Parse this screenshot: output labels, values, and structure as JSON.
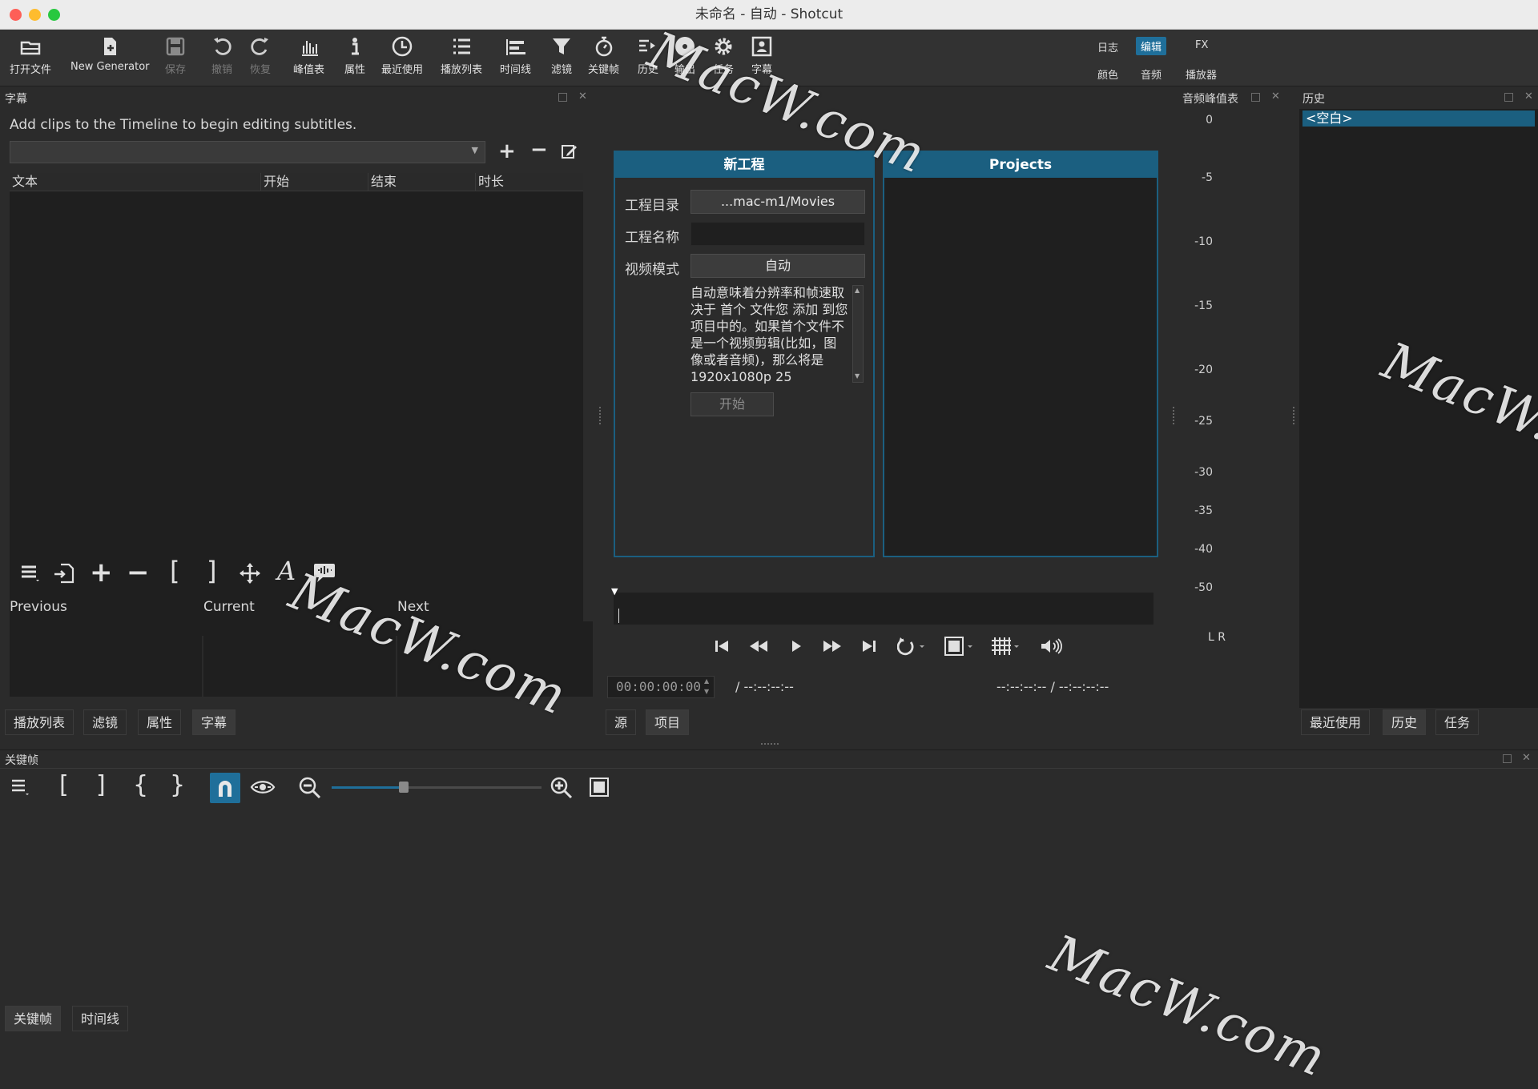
{
  "window": {
    "title": "未命名 - 自动 - Shotcut"
  },
  "toolbar": {
    "open": "打开文件",
    "generator": "New Generator",
    "save": "保存",
    "undo": "撤销",
    "redo": "恢复",
    "peak": "峰值表",
    "props": "属性",
    "recent": "最近使用",
    "playlist": "播放列表",
    "timeline": "时间线",
    "filters": "滤镜",
    "keyframes": "关键帧",
    "history": "历史",
    "export": "输出",
    "jobs": "任务",
    "subtitles": "字幕"
  },
  "layouts": {
    "log": "日志",
    "edit": "编辑",
    "fx": "FX",
    "color": "颜色",
    "audio": "音频",
    "player": "播放器"
  },
  "subtitles_panel": {
    "title": "字幕",
    "message": "Add clips to the Timeline to begin editing subtitles.",
    "columns": [
      "文本",
      "开始",
      "结束",
      "时长"
    ],
    "previous": "Previous",
    "current": "Current",
    "next": "Next"
  },
  "left_tabs": [
    "播放列表",
    "滤镜",
    "属性",
    "字幕"
  ],
  "new_project": {
    "title": "新工程",
    "dir_label": "工程目录",
    "dir_value": "...mac-m1/Movies",
    "name_label": "工程名称",
    "name_value": "",
    "mode_label": "视频模式",
    "mode_value": "自动",
    "description": "自动意味着分辨率和帧速取决于 首个 文件您 添加 到您项目中的。如果首个文件不是一个视频剪辑(比如，图像或者音频)，那么将是 1920x1080p 25",
    "start": "开始"
  },
  "projects": {
    "title": "Projects"
  },
  "player": {
    "timecode": "00:00:00:00",
    "duration": "/ --:--:--:--",
    "in_out": "--:--:--:-- / --:--:--:--"
  },
  "center_tabs": [
    "源",
    "项目"
  ],
  "audio_meter": {
    "title": "音频峰值表",
    "scale": [
      "0",
      "-5",
      "-10",
      "-15",
      "-20",
      "-25",
      "-30",
      "-35",
      "-40",
      "-50"
    ],
    "channels": "L R"
  },
  "history_panel": {
    "title": "历史",
    "items": [
      "<空白>"
    ]
  },
  "right_tabs": [
    "最近使用",
    "历史",
    "任务"
  ],
  "keyframes_panel": {
    "title": "关键帧"
  },
  "bottom_tabs": [
    "关键帧",
    "时间线"
  ],
  "watermark": "MacW.com",
  "colors": {
    "accent": "#1f6f9a",
    "panel_header": "#1b5f80",
    "dark_bg": "#1f1f1f"
  }
}
